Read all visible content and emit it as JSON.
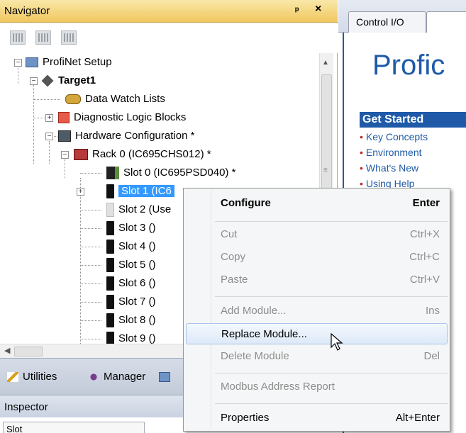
{
  "navigator": {
    "title": "Navigator",
    "pin_glyph": "ᵖ",
    "close_glyph": "×"
  },
  "tree": {
    "items": [
      {
        "label": "ProfiNet Setup",
        "icon": "profinet-setup-icon"
      },
      {
        "label": "Target1",
        "icon": "target-icon"
      },
      {
        "label": "Data Watch Lists",
        "icon": "data-watch-icon"
      },
      {
        "label": "Diagnostic Logic Blocks",
        "icon": "diagnostic-blocks-icon"
      },
      {
        "label": "Hardware Configuration *",
        "icon": "hardware-config-icon"
      },
      {
        "label": "Rack 0 (IC695CHS012) *",
        "icon": "rack-icon"
      },
      {
        "label": "Slot 0 (IC695PSD040) *",
        "icon": "power-supply-icon"
      },
      {
        "label": "Slot 1 (IC6",
        "icon": "module-icon"
      },
      {
        "label": "Slot 2 (Use",
        "icon": "module-icon"
      },
      {
        "label": "Slot 3 ()",
        "icon": "module-icon"
      },
      {
        "label": "Slot 4 ()",
        "icon": "module-icon"
      },
      {
        "label": "Slot 5 ()",
        "icon": "module-icon"
      },
      {
        "label": "Slot 6 ()",
        "icon": "module-icon"
      },
      {
        "label": "Slot 7 ()",
        "icon": "module-icon"
      },
      {
        "label": "Slot 8 ()",
        "icon": "module-icon"
      },
      {
        "label": "Slot 9 ()",
        "icon": "module-icon"
      }
    ]
  },
  "bottom_tabs": {
    "utilities": "Utilities",
    "manager": "Manager"
  },
  "inspector": {
    "title": "Inspector",
    "cell": "Slot"
  },
  "content": {
    "tab_label": "Control I/O",
    "heading": "Profic",
    "get_started": "Get Started",
    "links": [
      "Key Concepts",
      "Environment",
      "What's New",
      "Using Help"
    ]
  },
  "context_menu": {
    "items": [
      {
        "label": "Configure",
        "shortcut": "Enter"
      },
      {
        "label": "Cut",
        "shortcut": "Ctrl+X"
      },
      {
        "label": "Copy",
        "shortcut": "Ctrl+C"
      },
      {
        "label": "Paste",
        "shortcut": "Ctrl+V"
      },
      {
        "label": "Add Module...",
        "shortcut": "Ins"
      },
      {
        "label": "Replace Module...",
        "shortcut": ""
      },
      {
        "label": "Delete Module",
        "shortcut": "Del"
      },
      {
        "label": "Modbus Address Report",
        "shortcut": ""
      },
      {
        "label": "Properties",
        "shortcut": "Alt+Enter"
      }
    ]
  }
}
